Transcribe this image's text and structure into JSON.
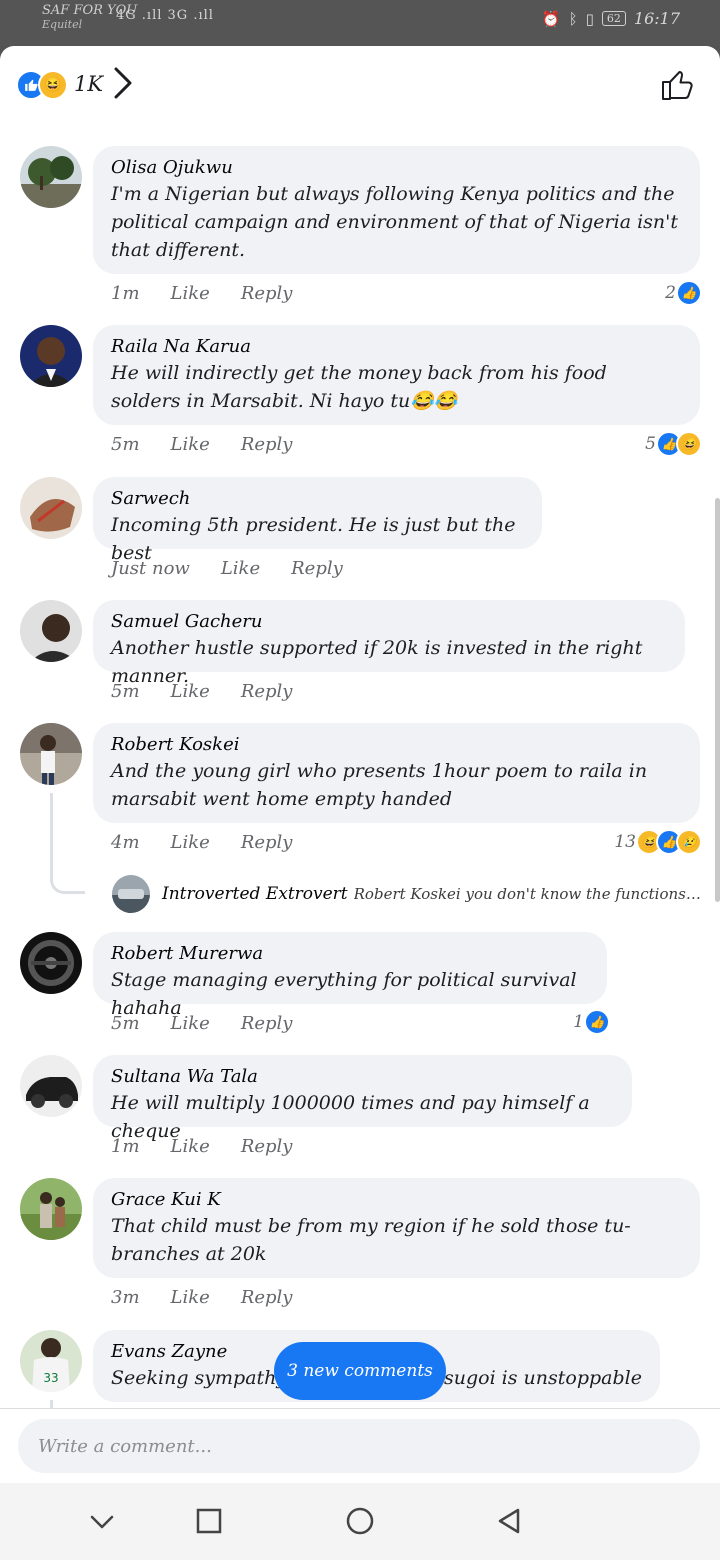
{
  "status_bar": {
    "carrier_line1": "SAF FOR YOU",
    "carrier_line2": "Equitel",
    "network": "4G .ıll 3G .ıll",
    "battery": "62",
    "time": "16:17"
  },
  "header": {
    "reaction_count": "1K",
    "chevron": "›"
  },
  "comments": [
    {
      "author": "Olisa Ojukwu",
      "text": "I'm a Nigerian but always following Kenya politics and the political campaign and environment of that of Nigeria isn't that different.",
      "time": "1m",
      "like": "Like",
      "reply": "Reply",
      "reactions": "2"
    },
    {
      "author": "Raila Na Karua",
      "text": "He will indirectly get the money back from his food solders in Marsabit. Ni hayo tu😂😂",
      "time": "5m",
      "like": "Like",
      "reply": "Reply",
      "reactions": "5"
    },
    {
      "author": "Sarwech",
      "text": "Incoming 5th president. He is just but the best",
      "time": "Just now",
      "like": "Like",
      "reply": "Reply"
    },
    {
      "author": "Samuel Gacheru",
      "text": "Another hustle supported if 20k is invested in the right manner.",
      "time": "5m",
      "like": "Like",
      "reply": "Reply"
    },
    {
      "author": "Robert Koskei",
      "text": "And the young girl who presents 1hour poem to raila in marsabit went home empty handed",
      "time": "4m",
      "like": "Like",
      "reply": "Reply",
      "reactions": "13"
    },
    {
      "author": "Robert Murerwa",
      "text": "Stage managing everything for political survival hahaha",
      "time": "5m",
      "like": "Like",
      "reply": "Reply",
      "reactions": "1"
    },
    {
      "author": "Sultana Wa Tala",
      "text": "He will multiply 1000000 times and pay himself a cheque",
      "time": "1m",
      "like": "Like",
      "reply": "Reply"
    },
    {
      "author": "Grace Kui K",
      "text": "That child must be from my region if he sold those tu-branches at 20k",
      "time": "3m",
      "like": "Like",
      "reply": "Reply"
    },
    {
      "author": "Evans Zayne",
      "text_left": "Seeking sympathy w",
      "text_right": "o sugoi is unstoppable"
    }
  ],
  "reply_preview": {
    "author": "Introverted Extrovert",
    "text": "Robert Koskei you don't know the functions of t..."
  },
  "new_comments_pill": "3 new comments",
  "composer": {
    "placeholder": "Write a comment..."
  },
  "icons": {
    "like": "👍",
    "haha": "😆",
    "sad": "😢"
  },
  "colors": {
    "accent": "#1877f2",
    "bubble": "#f0f2f5",
    "meta": "#65676b"
  }
}
